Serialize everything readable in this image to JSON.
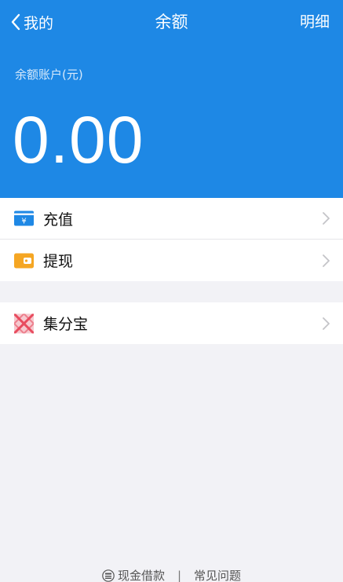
{
  "nav": {
    "back_label": "我的",
    "title": "余额",
    "detail_label": "明细"
  },
  "account": {
    "label": "余额账户(元)",
    "balance": "0.00"
  },
  "menu": [
    {
      "label": "充值",
      "icon": "recharge-icon",
      "color": "#1e88e5"
    },
    {
      "label": "提现",
      "icon": "withdraw-wallet-icon",
      "color": "#f5a623"
    }
  ],
  "menu2": [
    {
      "label": "集分宝",
      "icon": "jifenbao-icon",
      "color": "#e84c5f"
    }
  ],
  "footer": {
    "loan_label": "现金借款",
    "separator": "|",
    "faq_label": "常见问题"
  },
  "colors": {
    "header_bg": "#1e88e5",
    "page_bg": "#f2f2f6"
  }
}
